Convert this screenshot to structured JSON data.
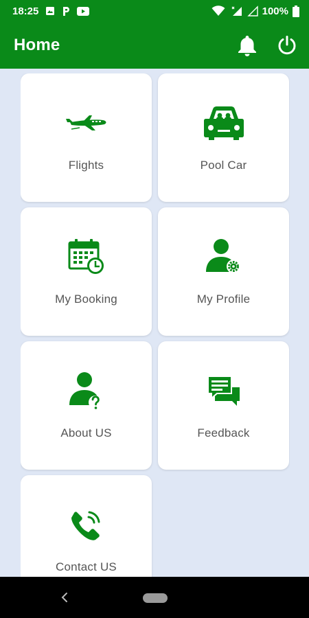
{
  "status_bar": {
    "time": "18:25",
    "battery": "100%"
  },
  "app_bar": {
    "title": "Home",
    "bell_icon": "notification-bell-icon",
    "power_icon": "power-icon"
  },
  "colors": {
    "primary": "#0a8a19",
    "background": "#dfe7f5",
    "card": "#ffffff",
    "label": "#555555"
  },
  "tiles": [
    {
      "label": "Flights",
      "icon": "airplane-icon"
    },
    {
      "label": "Pool Car",
      "icon": "car-icon"
    },
    {
      "label": "My Booking",
      "icon": "calendar-clock-icon"
    },
    {
      "label": "My Profile",
      "icon": "user-settings-icon"
    },
    {
      "label": "About US",
      "icon": "user-question-icon"
    },
    {
      "label": "Feedback",
      "icon": "chat-bubbles-icon"
    },
    {
      "label": "Contact US",
      "icon": "phone-icon"
    }
  ]
}
